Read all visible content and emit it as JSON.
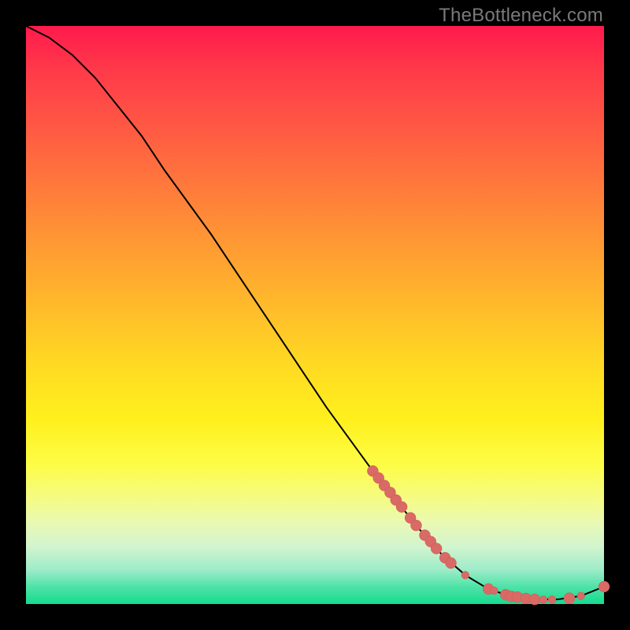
{
  "watermark": "TheBottleneck.com",
  "colors": {
    "curve_stroke": "#000000",
    "marker_fill": "#d96a65",
    "marker_stroke": "#c95a55"
  },
  "chart_data": {
    "type": "line",
    "title": "",
    "xlabel": "",
    "ylabel": "",
    "xlim": [
      0,
      100
    ],
    "ylim": [
      0,
      100
    ],
    "grid": false,
    "legend": false,
    "series": [
      {
        "name": "bottleneck-curve",
        "x": [
          0,
          4,
          8,
          12,
          16,
          20,
          24,
          28,
          32,
          36,
          40,
          44,
          48,
          52,
          56,
          60,
          64,
          68,
          72,
          76,
          80,
          84,
          88,
          92,
          96,
          100
        ],
        "y": [
          100,
          98,
          95,
          91,
          86,
          81,
          75,
          69.5,
          64,
          58,
          52,
          46,
          40,
          34,
          28.5,
          23,
          18,
          13,
          8.5,
          5,
          2.6,
          1.3,
          0.8,
          0.8,
          1.4,
          3
        ]
      }
    ],
    "markers": [
      {
        "x": 60.0,
        "y": 23.0,
        "r": 1.0
      },
      {
        "x": 61.0,
        "y": 21.8,
        "r": 1.0
      },
      {
        "x": 62.0,
        "y": 20.5,
        "r": 1.0
      },
      {
        "x": 63.0,
        "y": 19.3,
        "r": 1.0
      },
      {
        "x": 64.0,
        "y": 18.0,
        "r": 1.0
      },
      {
        "x": 65.0,
        "y": 16.8,
        "r": 1.0
      },
      {
        "x": 66.5,
        "y": 14.9,
        "r": 1.0
      },
      {
        "x": 67.5,
        "y": 13.6,
        "r": 1.0
      },
      {
        "x": 69.0,
        "y": 11.9,
        "r": 1.0
      },
      {
        "x": 70.0,
        "y": 10.8,
        "r": 1.0
      },
      {
        "x": 71.0,
        "y": 9.6,
        "r": 1.0
      },
      {
        "x": 72.5,
        "y": 8.0,
        "r": 1.0
      },
      {
        "x": 73.5,
        "y": 7.1,
        "r": 1.0
      },
      {
        "x": 76.0,
        "y": 5.0,
        "r": 0.7
      },
      {
        "x": 80.0,
        "y": 2.6,
        "r": 1.0
      },
      {
        "x": 81.0,
        "y": 2.3,
        "r": 0.7
      },
      {
        "x": 83.0,
        "y": 1.6,
        "r": 1.0
      },
      {
        "x": 84.0,
        "y": 1.3,
        "r": 1.0
      },
      {
        "x": 85.0,
        "y": 1.2,
        "r": 1.0
      },
      {
        "x": 86.5,
        "y": 0.95,
        "r": 1.0
      },
      {
        "x": 88.0,
        "y": 0.8,
        "r": 1.0
      },
      {
        "x": 89.5,
        "y": 0.75,
        "r": 0.7
      },
      {
        "x": 91.0,
        "y": 0.77,
        "r": 0.7
      },
      {
        "x": 94.0,
        "y": 1.0,
        "r": 1.0
      },
      {
        "x": 96.0,
        "y": 1.4,
        "r": 0.7
      },
      {
        "x": 100.0,
        "y": 3.0,
        "r": 1.0
      }
    ]
  }
}
